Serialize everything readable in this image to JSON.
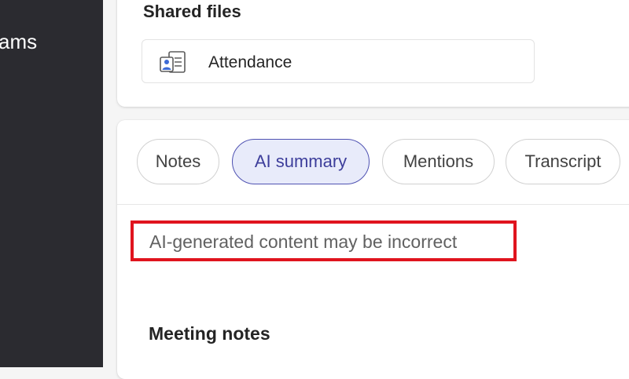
{
  "sidebar": {
    "app_label": "ams"
  },
  "shared_files": {
    "title": "Shared files",
    "files": [
      {
        "name": "Attendance",
        "icon": "attendance-file-icon"
      }
    ]
  },
  "tabs": [
    {
      "label": "Notes",
      "active": false
    },
    {
      "label": "AI summary",
      "active": true
    },
    {
      "label": "Mentions",
      "active": false
    },
    {
      "label": "Transcript",
      "active": false
    }
  ],
  "disclaimer": "AI-generated content may be incorrect",
  "notes_heading": "Meeting notes",
  "colors": {
    "sidebar_bg": "#2b2b30",
    "accent": "#4f52b2",
    "active_tab_bg": "#e8ebfa",
    "highlight_box": "#e0141e"
  }
}
